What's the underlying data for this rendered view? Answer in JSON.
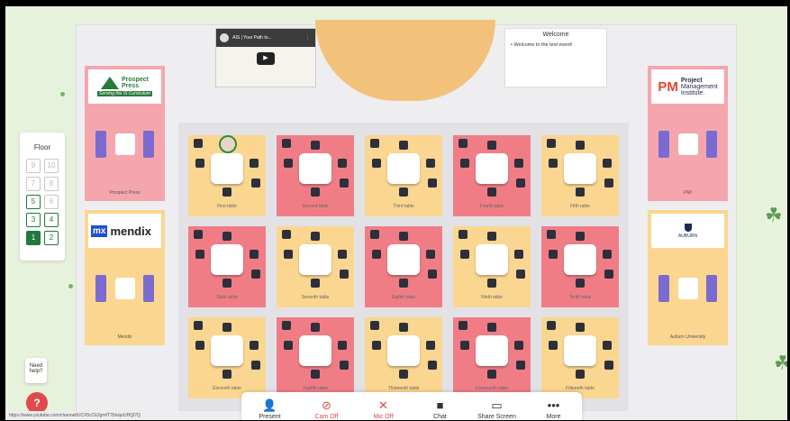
{
  "floor": {
    "title": "Floor",
    "buttons": [
      {
        "label": "9",
        "state": "disabled"
      },
      {
        "label": "10",
        "state": "disabled"
      },
      {
        "label": "7",
        "state": "disabled"
      },
      {
        "label": "8",
        "state": "disabled"
      },
      {
        "label": "5",
        "state": "active"
      },
      {
        "label": "6",
        "state": "disabled"
      },
      {
        "label": "3",
        "state": "active"
      },
      {
        "label": "4",
        "state": "active"
      },
      {
        "label": "1",
        "state": "selected"
      },
      {
        "label": "2",
        "state": "active"
      }
    ]
  },
  "video": {
    "title": "AIS | Your Path to..."
  },
  "welcome": {
    "title": "Welcome",
    "message": "Welcome to the test event!"
  },
  "booths": {
    "prospect_press": {
      "logo_line1": "Prospect",
      "logo_line2": "Press",
      "tagline": "Serving the IS Curriculum",
      "label": "Prospect Press"
    },
    "mendix": {
      "logo_mark": "mx",
      "logo_text": "mendix",
      "label": "Mendix"
    },
    "pmi": {
      "logo_mark": "PM",
      "logo_line1": "Project",
      "logo_line2": "Management",
      "logo_line3": "Institute.",
      "label": "PMI"
    },
    "auburn": {
      "logo_text": "AUBURN",
      "label": "Auburn University"
    }
  },
  "tables": [
    {
      "label": "First table",
      "color": "y"
    },
    {
      "label": "Second table",
      "color": "r"
    },
    {
      "label": "Third table",
      "color": "y"
    },
    {
      "label": "Fourth table",
      "color": "r"
    },
    {
      "label": "Fifth table",
      "color": "y"
    },
    {
      "label": "Sixth table",
      "color": "r"
    },
    {
      "label": "Seventh table",
      "color": "y"
    },
    {
      "label": "Eighth table",
      "color": "r"
    },
    {
      "label": "Ninth table",
      "color": "y"
    },
    {
      "label": "Tenth table",
      "color": "r"
    },
    {
      "label": "Eleventh table",
      "color": "y"
    },
    {
      "label": "Twelfth table",
      "color": "r"
    },
    {
      "label": "Thirteenth table",
      "color": "y"
    },
    {
      "label": "Fourteenth table",
      "color": "r"
    },
    {
      "label": "Fifteenth table",
      "color": "y"
    }
  ],
  "toolbar": {
    "present": "Present",
    "cam_off": "Cam Off",
    "mic_off": "Mic Off",
    "chat": "Chat",
    "share": "Share Screen",
    "more": "More"
  },
  "help": {
    "line1": "Need",
    "line2": "help?"
  },
  "status_url": "https://www.youtube.com/channel/UCX5cCk2gmfT7bIvqoUHQl7Q",
  "colors": {
    "yellow_tile": "#fbd690",
    "red_tile": "#f07d86",
    "floor_selected": "#1e7a3c",
    "off_red": "#e04848"
  }
}
